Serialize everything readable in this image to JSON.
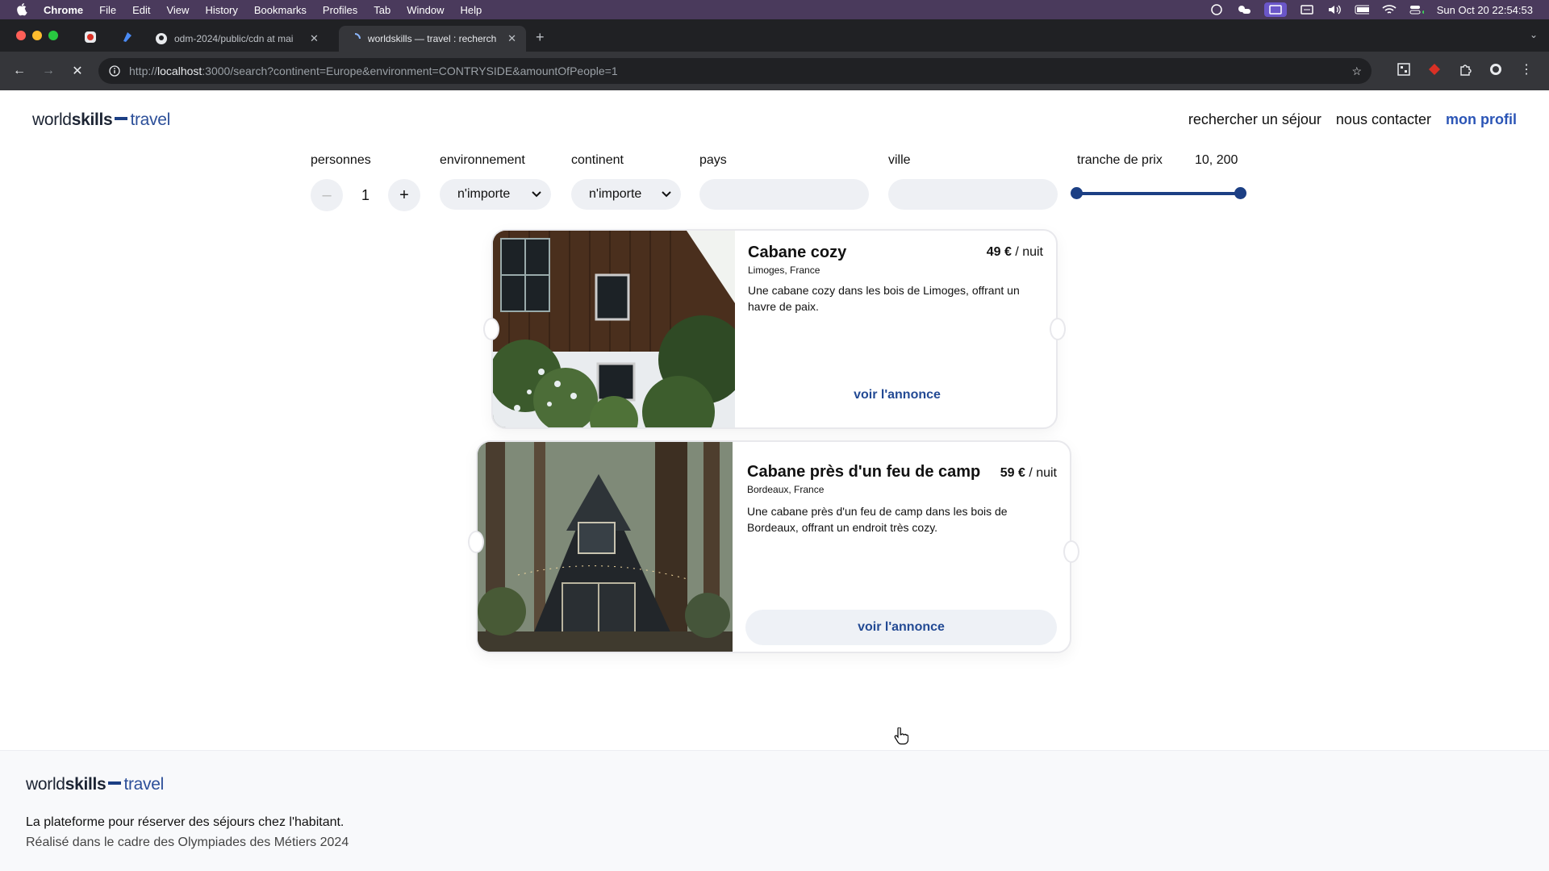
{
  "menubar": {
    "app": "Chrome",
    "items": [
      "File",
      "Edit",
      "View",
      "History",
      "Bookmarks",
      "Profiles",
      "Tab",
      "Window",
      "Help"
    ],
    "clock": "Sun Oct 20  22:54:53"
  },
  "tabs": [
    {
      "title": "odm-2024/public/cdn at mai"
    },
    {
      "title": "worldskills — travel : recherch"
    }
  ],
  "url": {
    "prefix": "http://",
    "host": "localhost",
    "rest": ":3000/search?continent=Europe&environment=CONTRYSIDE&amountOfPeople=1"
  },
  "logo": {
    "world": "world",
    "skills": "skills",
    "travel": "travel"
  },
  "nav": {
    "search": "rechercher un séjour",
    "contact": "nous contacter",
    "profile": "mon profil"
  },
  "filters": {
    "people_label": "personnes",
    "people_value": "1",
    "minus": "–",
    "plus": "+",
    "environment_label": "environnement",
    "environment_value": "n'importe",
    "continent_label": "continent",
    "continent_value": "n'importe",
    "country_label": "pays",
    "city_label": "ville",
    "price_label": "tranche de prix",
    "price_value": "10, 200",
    "price_min": 10,
    "price_max": 200
  },
  "listings": [
    {
      "title": "Cabane cozy",
      "location": "Limoges, France",
      "price": "49 €",
      "unit": "/ nuit",
      "description": "Une cabane cozy dans les bois de Limoges, offrant un havre de paix.",
      "button": "voir l'annonce"
    },
    {
      "title": "Cabane près d'un feu de camp",
      "location": "Bordeaux, France",
      "price": "59 €",
      "unit": "/ nuit",
      "description": "Une cabane près d'un feu de camp dans les bois de Bordeaux, offrant un endroit très cozy.",
      "button": "voir l'annonce"
    }
  ],
  "footer": {
    "tagline": "La plateforme pour réserver des séjours chez l'habitant.",
    "subtitle": "Réalisé dans le cadre des Olympiades des Métiers 2024"
  }
}
